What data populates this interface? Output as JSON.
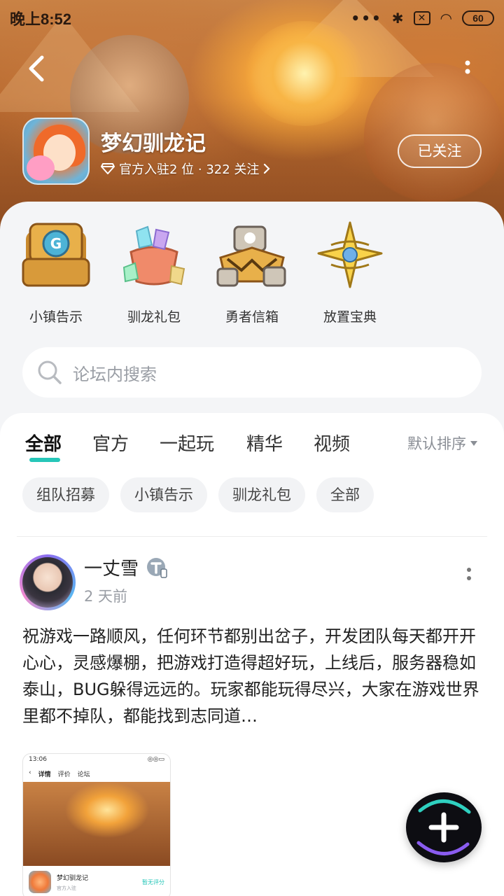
{
  "status_bar": {
    "time": "晚上8:52",
    "battery": "60"
  },
  "forum": {
    "title": "梦幻驯龙记",
    "subtitle": "官方入驻2 位 · 322 关注",
    "follow_label": "已关注"
  },
  "shortcuts": [
    {
      "label": "小镇告示",
      "icon": "treasure-chest-icon"
    },
    {
      "label": "驯龙礼包",
      "icon": "gift-bag-icon"
    },
    {
      "label": "勇者信箱",
      "icon": "mailbox-icon"
    },
    {
      "label": "放置宝典",
      "icon": "star-book-icon"
    }
  ],
  "search": {
    "placeholder": "论坛内搜索"
  },
  "tabs": [
    {
      "label": "全部",
      "active": true
    },
    {
      "label": "官方"
    },
    {
      "label": "一起玩"
    },
    {
      "label": "精华"
    },
    {
      "label": "视频"
    }
  ],
  "sort_label": "默认排序",
  "chips": [
    "组队招募",
    "小镇告示",
    "驯龙礼包",
    "全部"
  ],
  "post": {
    "author": "一丈雪",
    "time": "2 天前",
    "body": "祝游戏一路顺风，任何环节都别出岔子，开发团队每天都开开心心，灵感爆棚，把游戏打造得超好玩，上线后，服务器稳如泰山，BUG躲得远远的。玩家都能玩得尽兴，大家在游戏世界里都不掉队，都能找到志同道…",
    "thumbnail": {
      "time": "13:06",
      "nav": [
        "详情",
        "评价",
        "论坛"
      ],
      "app_name": "梦幻驯龙记",
      "rating": "暂无评分",
      "tag": "官方入驻"
    }
  },
  "colors": {
    "accent": "#26c6b8",
    "sheet_bg": "#f4f5f7"
  }
}
